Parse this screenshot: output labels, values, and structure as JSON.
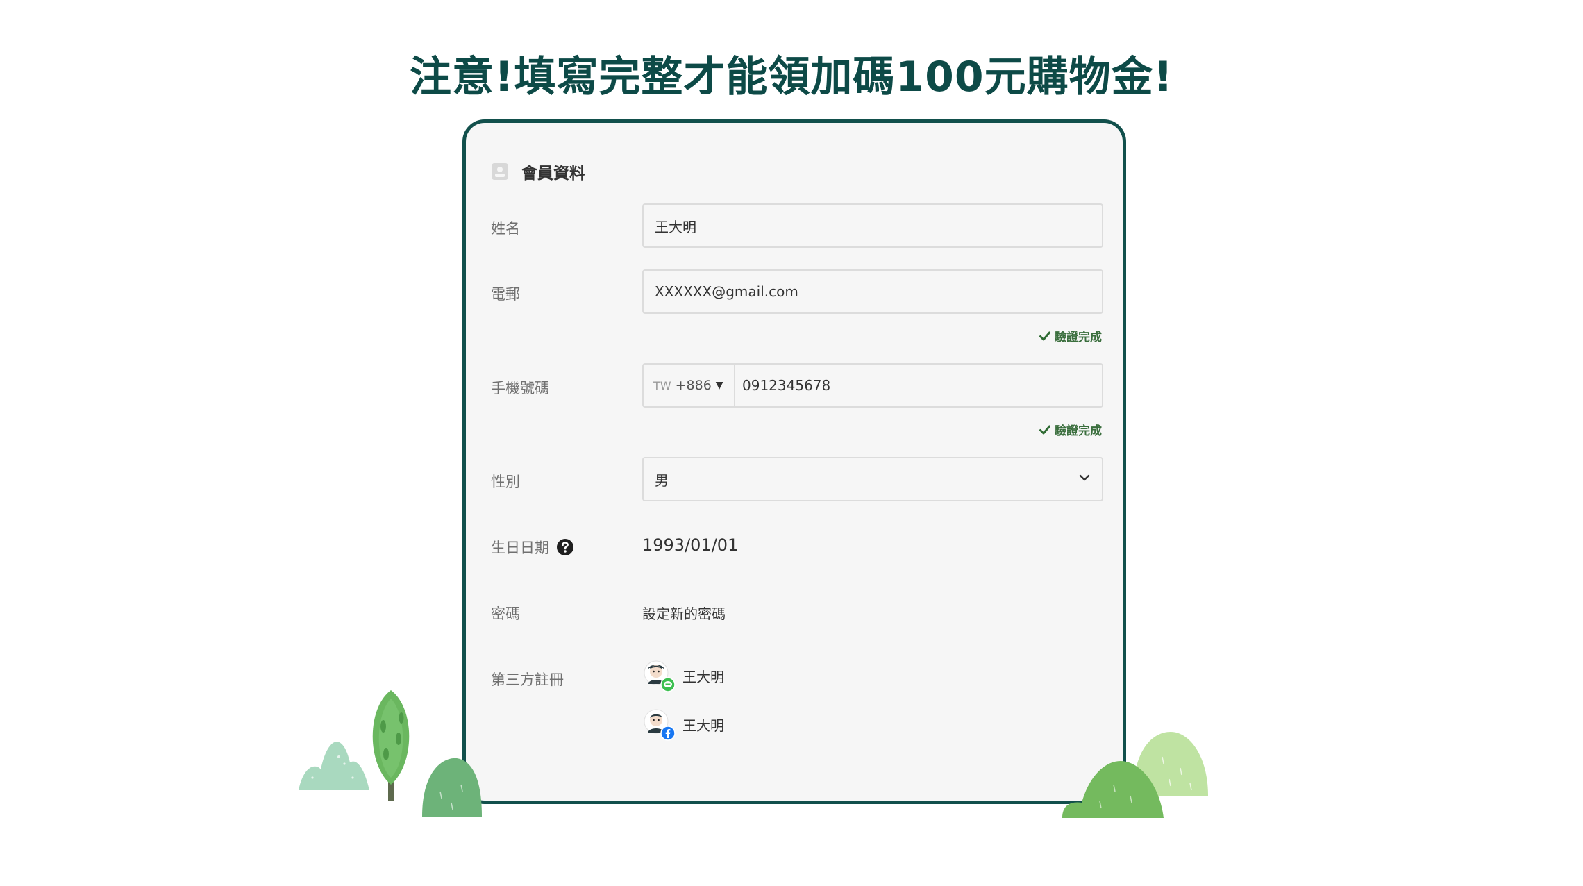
{
  "headline": "注意!填寫完整才能領加碼100元購物金!",
  "section": {
    "title": "會員資料",
    "icon": "member-card-icon"
  },
  "fields": {
    "name": {
      "label": "姓名",
      "value": "王大明"
    },
    "email": {
      "label": "電郵",
      "value": "XXXXXX@gmail.com",
      "verified": "驗證完成"
    },
    "phone": {
      "label": "手機號碼",
      "country": "TW",
      "code": "+886",
      "value": "0912345678",
      "verified": "驗證完成"
    },
    "gender": {
      "label": "性別",
      "value": "男"
    },
    "birthday": {
      "label": "生日日期",
      "value": "1993/01/01"
    },
    "password": {
      "label": "密碼",
      "value": "設定新的密碼"
    },
    "third_party": {
      "label": "第三方註冊",
      "accounts": [
        {
          "provider": "LINE",
          "name": "王大明",
          "badge_color": "#3cbf50"
        },
        {
          "provider": "Facebook",
          "name": "王大明",
          "badge_color": "#1877f2"
        }
      ]
    }
  },
  "colors": {
    "headline": "#0d4a47",
    "border": "#12504c",
    "verified": "#3a6e3d"
  }
}
